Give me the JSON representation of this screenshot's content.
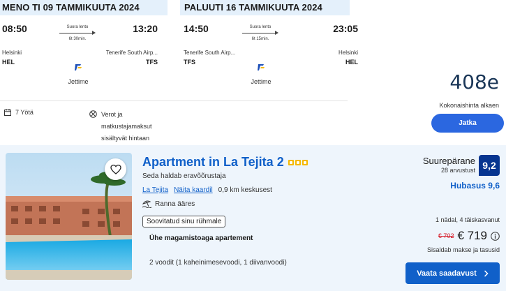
{
  "outbound": {
    "header": "MENO TI 09 TAMMIKUUTA 2024",
    "dep_time": "08:50",
    "arr_time": "13:20",
    "segment_label": "Suora lento",
    "duration": "6t 30min.",
    "dep_city": "Helsinki",
    "arr_city": "Tenerife South Airp...",
    "dep_code": "HEL",
    "arr_code": "TFS",
    "airline": "Jettime"
  },
  "return": {
    "header": "PALUUTI 16 TAMMIKUUTA 2024",
    "dep_time": "14:50",
    "arr_time": "23:05",
    "segment_label": "Suora lento",
    "duration": "6t 15min.",
    "dep_city": "Tenerife South Airp...",
    "arr_city": "Helsinki",
    "dep_code": "TFS",
    "arr_code": "HEL",
    "airline": "Jettime"
  },
  "package": {
    "nights": "7 Yötä",
    "taxes_note": "Verot ja matkustajamaksut sisältyvät hintaan",
    "total_price": "408e",
    "total_label": "Kokonaishinta alkaen",
    "continue_label": "Jatka"
  },
  "hotel": {
    "name": "Apartment in La Tejita 2",
    "star_count": 3,
    "host_note": "Seda haldab eravõõrustaja",
    "location_link": "La Tejita",
    "map_link": "Näita kaardil",
    "distance": "0,9 km keskusest",
    "beach": "Ranna ääres",
    "group_badge": "Soovitatud sinu rühmale",
    "room_type": "Ühe magamistoaga apartement",
    "beds": "2 voodit (1 kaheinimesevoodi, 1 diivanvoodi)",
    "rating_word": "Suurepärane",
    "review_count": "28 arvustust",
    "score": "9,2",
    "location_score": "Hubasus 9,6",
    "stay_info": "1 nädal, 4 täiskasvanut",
    "old_price": "€ 702",
    "new_price": "€ 719",
    "tax_note": "Sisaldab makse ja tasusid",
    "availability_label": "Vaata saadavust"
  },
  "colors": {
    "header_bg": "#e4f0fb",
    "primary_blue": "#1060c9",
    "continue_blue": "#2b67e0",
    "score_navy": "#073590",
    "price_navy": "#1a3657",
    "old_price_red": "#d4111e",
    "star_yellow": "#f5b800",
    "hotel_bg": "#eef5fc"
  },
  "icons": {
    "nights": "calendar-icon",
    "taxes": "no-fee-icon",
    "airline": "jettime-logo-icon",
    "favorite": "heart-icon",
    "beach": "beach-umbrella-icon",
    "info": "info-icon",
    "availability": "chevron-right-icon"
  }
}
